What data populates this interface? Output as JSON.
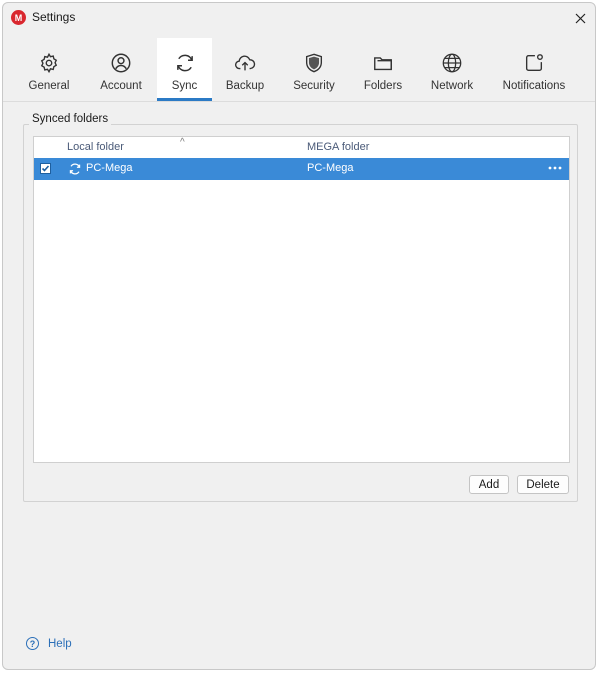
{
  "window": {
    "title": "Settings",
    "logo_letter": "M"
  },
  "tabs": [
    {
      "id": "general",
      "label": "General",
      "icon": "gear-icon"
    },
    {
      "id": "account",
      "label": "Account",
      "icon": "user-circle-icon"
    },
    {
      "id": "sync",
      "label": "Sync",
      "icon": "sync-icon",
      "active": true
    },
    {
      "id": "backup",
      "label": "Backup",
      "icon": "cloud-upload-icon"
    },
    {
      "id": "security",
      "label": "Security",
      "icon": "shield-icon"
    },
    {
      "id": "folders",
      "label": "Folders",
      "icon": "folder-icon"
    },
    {
      "id": "network",
      "label": "Network",
      "icon": "globe-icon"
    },
    {
      "id": "notifications",
      "label": "Notifications",
      "icon": "notification-icon"
    }
  ],
  "synced_folders": {
    "group_title": "Synced folders",
    "columns": {
      "local": "Local folder",
      "mega": "MEGA folder"
    },
    "sort_indicator": "^",
    "rows": [
      {
        "checked": true,
        "local_folder": "PC-Mega",
        "mega_folder": "PC-Mega",
        "more": "•••"
      }
    ],
    "add_label": "Add",
    "delete_label": "Delete"
  },
  "help": {
    "label": "Help",
    "icon_glyph": "?"
  },
  "colors": {
    "accent": "#2b7ac5",
    "selection": "#3a8ad7",
    "brand_red": "#d9272e",
    "link": "#2b6fb8"
  }
}
